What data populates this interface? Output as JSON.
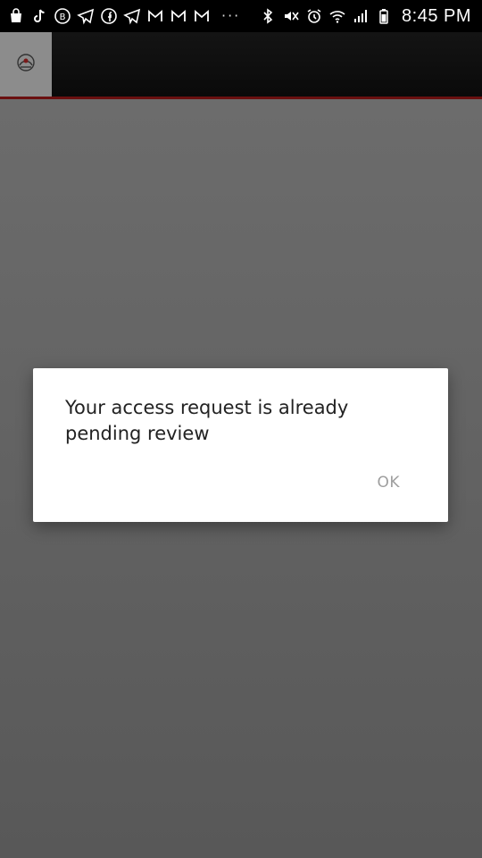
{
  "status_bar": {
    "notification_icons": [
      "shopping-bag-icon",
      "tiktok-icon",
      "b-circle-icon",
      "telegram-icon",
      "facebook-icon",
      "telegram-icon",
      "gmail-icon",
      "gmail-icon",
      "gmail-icon"
    ],
    "overflow": "···",
    "system_icons": [
      "bluetooth-icon",
      "mute-icon",
      "alarm-icon",
      "wifi-icon",
      "signal-icon",
      "battery-icon"
    ],
    "time": "8:45 PM"
  },
  "app_bar": {
    "logo_icon": "app-logo-icon",
    "accent_color": "#6a1010"
  },
  "dialog": {
    "message": "Your access request is already pending review",
    "ok_label": "OK"
  }
}
